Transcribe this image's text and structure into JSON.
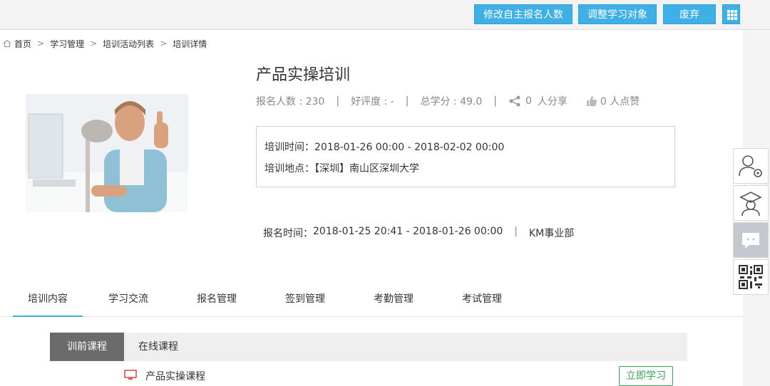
{
  "toolbar": {
    "modify_count_label": "修改自主报名人数",
    "adjust_target_label": "调整学习对象",
    "discard_label": "废弃"
  },
  "breadcrumb": [
    "首页",
    "学习管理",
    "培训活动列表",
    "培训详情"
  ],
  "training": {
    "title": "产品实操培训",
    "signup_count": "报名人数 : 230",
    "rating": "好评度 : -",
    "total_credit": "总学分 : 49.0",
    "share_count": "0",
    "share_label": "人分享",
    "like_text": "0 人点赞",
    "time_label": "培训时间：",
    "time_value": "2018-01-26 00:00 - 2018-02-02 00:00",
    "location_label": "培训地点：",
    "location_value": "【深圳】南山区深圳大学",
    "signup_time_label": "报名时间：",
    "signup_time_value": "2018-01-25 20:41 - 2018-01-26 00:00",
    "department": "KM事业部"
  },
  "tabs": [
    "培训内容",
    "学习交流",
    "报名管理",
    "签到管理",
    "考勤管理",
    "考试管理"
  ],
  "subtabs": [
    "训前课程",
    "在线课程"
  ],
  "course": {
    "name": "产品实操课程",
    "action_label": "立即学习"
  },
  "colors": {
    "accent": "#3fb0e6",
    "study_green": "#35a853",
    "active_subtab": "#6b6b6b"
  },
  "icons": [
    "home-icon",
    "share-icon",
    "thumbs-up-icon",
    "grid-menu-icon",
    "user-settings-icon",
    "graduate-icon",
    "chat-icon",
    "qr-code-icon",
    "monitor-icon"
  ]
}
